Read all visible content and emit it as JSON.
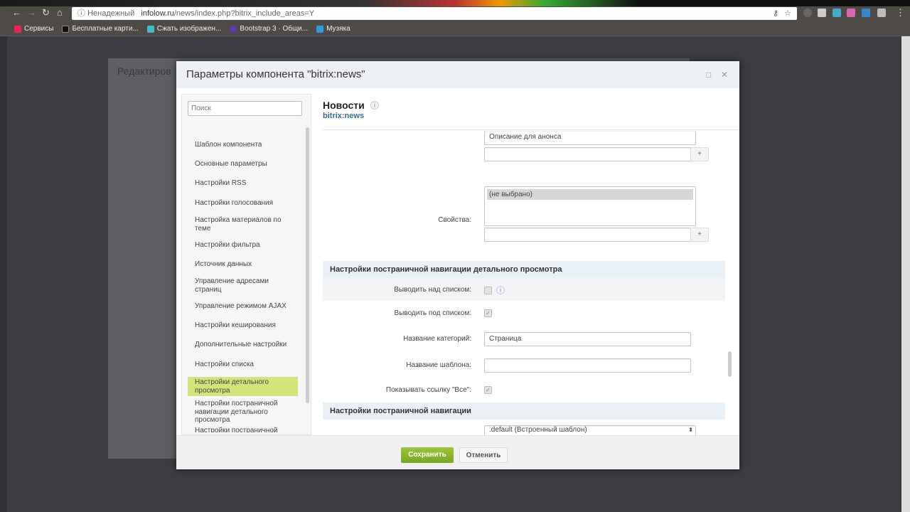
{
  "browser": {
    "insecure_label": "Ненадежный",
    "url_host": "infolow.ru",
    "url_path": "/news/index.php?bitrix_include_areas=Y",
    "bookmarks": [
      {
        "label": "Сервисы",
        "color": "#e25"
      },
      {
        "label": "Бесплатные карти...",
        "color": "#111"
      },
      {
        "label": "Сжать изображен...",
        "color": "#4bc"
      },
      {
        "label": "Bootstrap 3 · Общи...",
        "color": "#5a3e9e"
      },
      {
        "label": "Музяка",
        "color": "#39d"
      }
    ]
  },
  "background": {
    "editor_title": "Редактиров"
  },
  "dialog": {
    "title": "Параметры компонента \"bitrix:news\"",
    "search_placeholder": "Поиск",
    "sidebar": [
      "Шаблон компонента",
      "Основные параметры",
      "Настройки RSS",
      "Настройки голосования",
      "Настройка материалов по теме",
      "Настройки фильтра",
      "Источник данных",
      "Управление адресами страниц",
      "Управление режимом AJAX",
      "Настройки кеширования",
      "Дополнительные настройки",
      "Настройки списка",
      "Настройки детального просмотра",
      "Настройки постраничной навигации детального просмотра",
      "Настройки постраничной"
    ],
    "active_index": 12,
    "component_name": "Новости",
    "component_code": "bitrix:news",
    "field_list_last": "Описание для анонса",
    "props_label": "Свойства:",
    "props_selected": "(не выбрано)",
    "plus": "+",
    "section1": "Настройки постраничной навигации детального просмотра",
    "above_label": "Выводить над списком:",
    "above_checked": false,
    "below_label": "Выводить под списком:",
    "below_checked": true,
    "category_label": "Название категорий:",
    "category_value": "Страница",
    "template_label": "Название шаблона:",
    "template_value": "",
    "showall_label": "Показывать ссылку \"Все\":",
    "showall_checked": true,
    "section2": "Настройки постраничной навигации",
    "pager_template": ".default (Встроенный шаблон)",
    "save": "Сохранить",
    "cancel": "Отменить"
  }
}
